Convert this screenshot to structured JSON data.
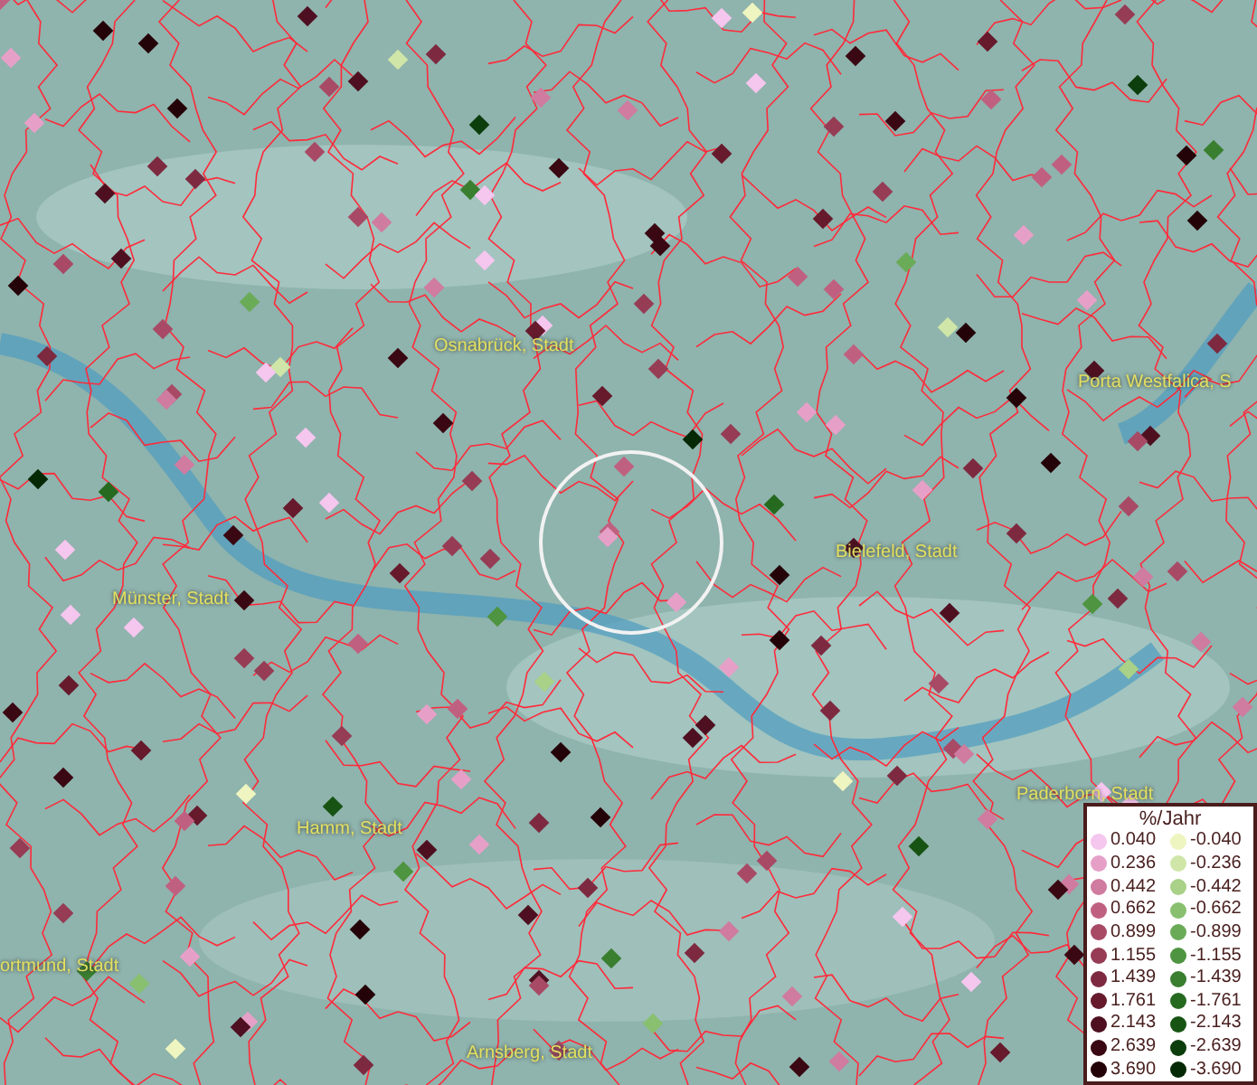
{
  "places": [
    {
      "name": "Osnabrück, Stadt"
    },
    {
      "name": "Porta Westfalica, S"
    },
    {
      "name": "Bielefeld, Stadt"
    },
    {
      "name": "Münster, Stadt"
    },
    {
      "name": "Paderborn, Stadt"
    },
    {
      "name": "Hamm, Stadt"
    },
    {
      "name": "ortmund, Stadt"
    },
    {
      "name": "Arnsberg, Stadt"
    }
  ],
  "legend": {
    "title": "%/Jahr",
    "rows": [
      {
        "positive": {
          "label": "0.040",
          "color": "#f5c6ee"
        },
        "negative": {
          "label": "-0.040",
          "color": "#eef5c0"
        }
      },
      {
        "positive": {
          "label": "0.236",
          "color": "#e6a0c8"
        },
        "negative": {
          "label": "-0.236",
          "color": "#cfe6a8"
        }
      },
      {
        "positive": {
          "label": "0.442",
          "color": "#d07ba0"
        },
        "negative": {
          "label": "-0.442",
          "color": "#a9d188"
        }
      },
      {
        "positive": {
          "label": "0.662",
          "color": "#c06080"
        },
        "negative": {
          "label": "-0.662",
          "color": "#88c070"
        }
      },
      {
        "positive": {
          "label": "0.899",
          "color": "#a84a66"
        },
        "negative": {
          "label": "-0.899",
          "color": "#6aab58"
        }
      },
      {
        "positive": {
          "label": "1.155",
          "color": "#963c55"
        },
        "negative": {
          "label": "-1.155",
          "color": "#4f9440"
        }
      },
      {
        "positive": {
          "label": "1.439",
          "color": "#7d2a40"
        },
        "negative": {
          "label": "-1.439",
          "color": "#3a7e30"
        }
      },
      {
        "positive": {
          "label": "1.761",
          "color": "#661a2c"
        },
        "negative": {
          "label": "-1.761",
          "color": "#266a20"
        }
      },
      {
        "positive": {
          "label": "2.143",
          "color": "#4e1020"
        },
        "negative": {
          "label": "-2.143",
          "color": "#175414"
        }
      },
      {
        "positive": {
          "label": "2.639",
          "color": "#3a0812"
        },
        "negative": {
          "label": "-2.639",
          "color": "#0c3d0c"
        }
      },
      {
        "positive": {
          "label": "3.690",
          "color": "#240308"
        },
        "negative": {
          "label": "-3.690",
          "color": "#052805"
        }
      }
    ]
  }
}
